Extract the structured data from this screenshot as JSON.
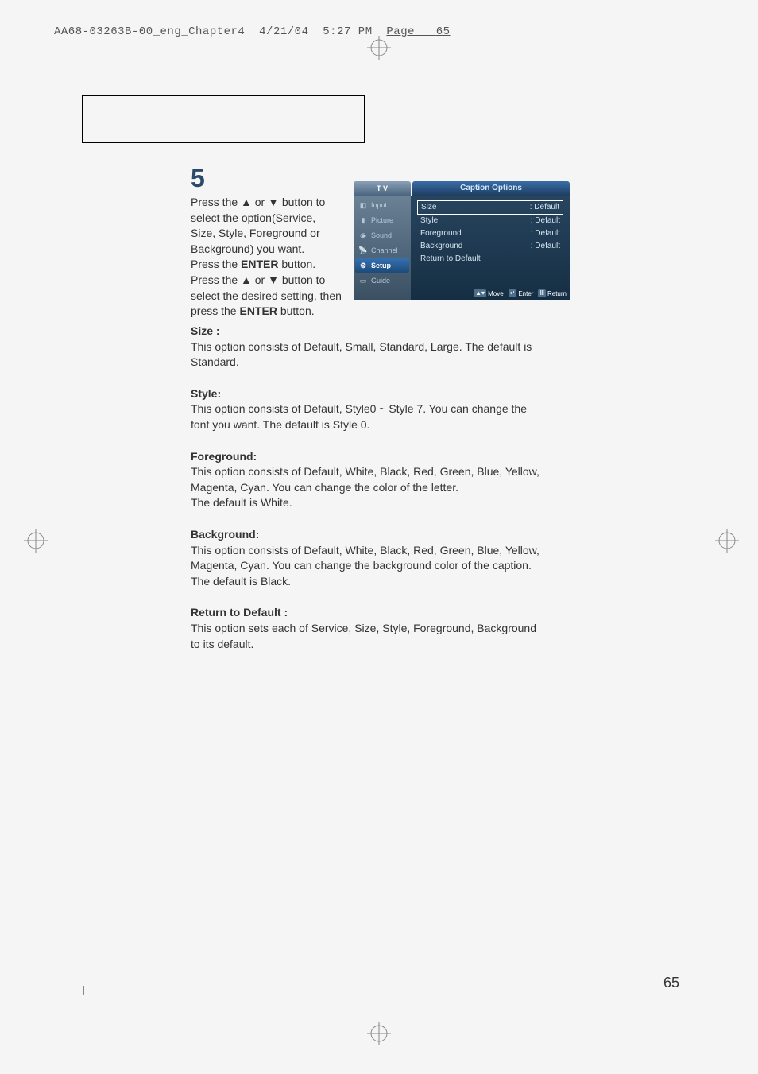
{
  "header": {
    "filename": "AA68-03263B-00_eng_Chapter4",
    "date": "4/21/04",
    "time": "5:27 PM",
    "page_label": "Page",
    "page_num": "65"
  },
  "step": {
    "number": "5",
    "line1": "Press the ▲ or ▼ button to select the option(Service, Size, Style, Foreground or Background) you want.",
    "line2_pre": "Press the ",
    "line2_bold": "ENTER",
    "line2_post": " button.",
    "line3": "Press  the ▲ or ▼ button to select the desired setting, then press the ",
    "line3_bold": "ENTER",
    "line3_post": " button."
  },
  "osd": {
    "tv_label": "T V",
    "title": "Caption Options",
    "tabs": [
      {
        "label": "Input"
      },
      {
        "label": "Picture"
      },
      {
        "label": "Sound"
      },
      {
        "label": "Channel"
      },
      {
        "label": "Setup"
      },
      {
        "label": "Guide"
      }
    ],
    "rows": [
      {
        "label": "Size",
        "value": ": Default"
      },
      {
        "label": "Style",
        "value": ": Default"
      },
      {
        "label": "Foreground",
        "value": ": Default"
      },
      {
        "label": "Background",
        "value": ": Default"
      },
      {
        "label": "Return to Default",
        "value": ""
      }
    ],
    "footer": {
      "move": "Move",
      "enter": "Enter",
      "return": "Return"
    }
  },
  "definitions": [
    {
      "title": "Size :",
      "body": "This option consists of Default, Small, Standard, Large. The default is Standard."
    },
    {
      "title": "Style:",
      "body": "This option consists of Default, Style0 ~ Style 7. You can change the font you want. The default is Style 0."
    },
    {
      "title": "Foreground:",
      "body": "This option consists of Default, White, Black, Red, Green, Blue, Yellow, Magenta, Cyan. You can change the color of the letter.\nThe default is White."
    },
    {
      "title": "Background:",
      "body": "This option consists of Default, White, Black, Red, Green, Blue, Yellow, Magenta, Cyan. You can change the background color of the caption. The default is Black."
    },
    {
      "title": "Return to Default :",
      "body": "This option sets each of Service, Size, Style, Foreground, Background to its default."
    }
  ],
  "page_number": "65"
}
